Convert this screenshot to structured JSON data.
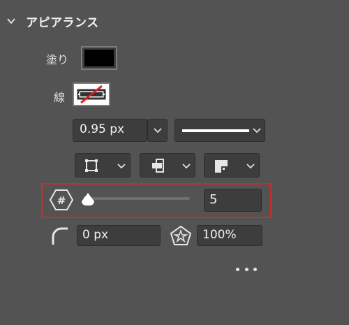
{
  "section": {
    "title": "アピアランス",
    "chevron_icon": "chevron-down-icon"
  },
  "fill": {
    "label": "塗り",
    "color": "#000000"
  },
  "stroke": {
    "label": "線",
    "swatch_colors": [
      "#ffffff",
      "#333333",
      "#d8241c"
    ]
  },
  "stroke_width": {
    "value": "0.95 px"
  },
  "stroke_style": {
    "selected": "solid-line"
  },
  "stroke_options": [
    {
      "icon": "stroke-align-icon"
    },
    {
      "icon": "cap-icon"
    },
    {
      "icon": "join-icon"
    }
  ],
  "polygon": {
    "icon": "sides-count-icon",
    "slider_value": 5,
    "slider_min": 3,
    "slider_max": 100,
    "value": "5",
    "highlight_color": "#c5312a"
  },
  "corner_radius": {
    "icon": "corner-radius-icon",
    "value": "0 px"
  },
  "star_ratio": {
    "icon": "star-ratio-icon",
    "value": "100%"
  },
  "more": {
    "icon": "more-options-icon"
  }
}
